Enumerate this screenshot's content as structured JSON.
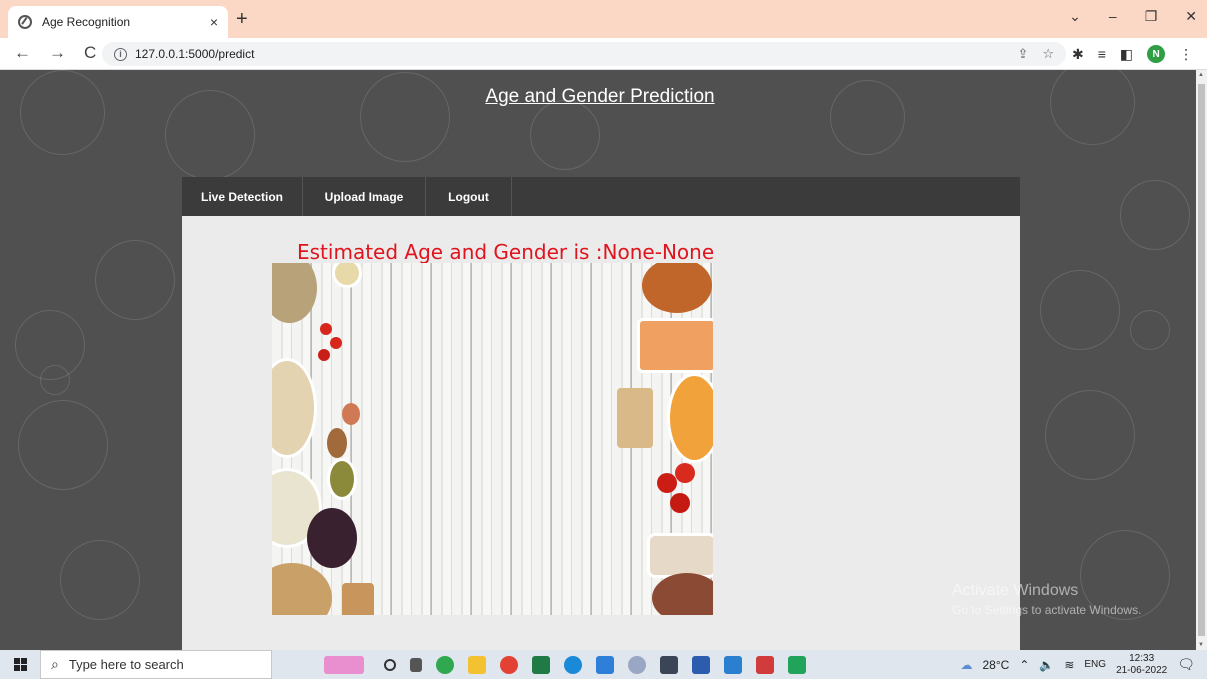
{
  "browser": {
    "tab_title": "Age Recognition",
    "tab_close": "×",
    "new_tab": "+",
    "url": "127.0.0.1:5000/predict",
    "window_controls": [
      "⌄",
      "–",
      "❐",
      "✕"
    ],
    "profile_initial": "N"
  },
  "page": {
    "title": "Age and Gender Prediction",
    "nav": [
      "Live Detection",
      "Upload Image",
      "Logout"
    ],
    "result_text": "Estimated Age and Gender is :None-None"
  },
  "watermark": {
    "line1": "Activate Windows",
    "line2": "Go to Settings to activate Windows."
  },
  "taskbar": {
    "search_placeholder": "Type here to search",
    "weather": "28°C",
    "language": "ENG",
    "time": "12:33",
    "date": "21-06-2022"
  }
}
